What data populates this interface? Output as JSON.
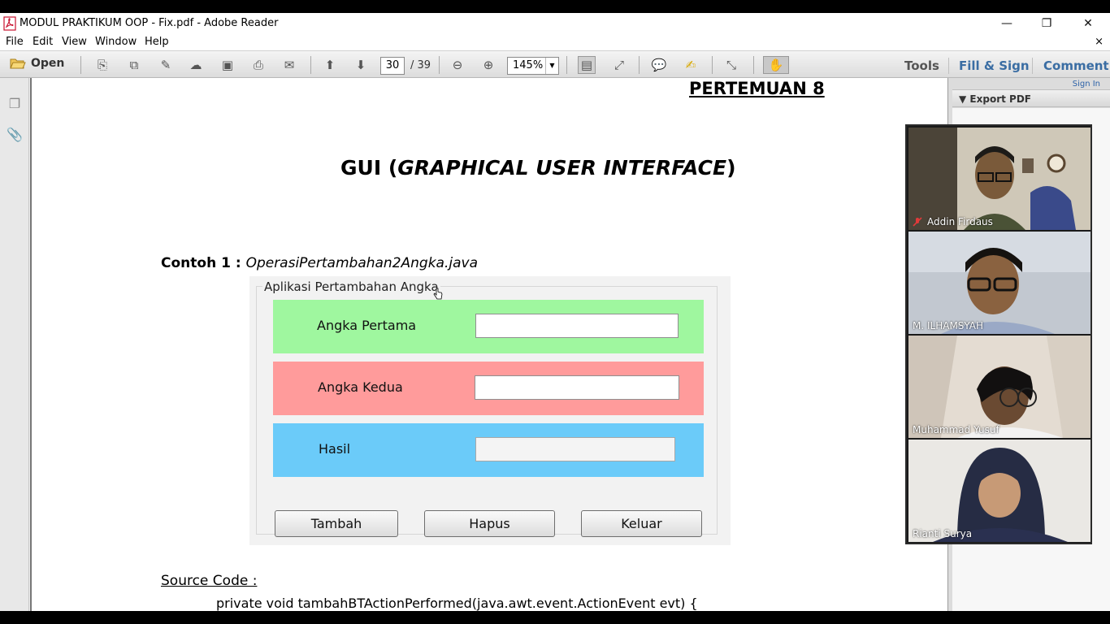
{
  "window": {
    "title": "MODUL PRAKTIKUM OOP - Fix.pdf - Adobe Reader",
    "minimize_glyph": "—",
    "maximize_glyph": "❐",
    "close_glyph": "✕"
  },
  "menu": {
    "items": [
      "File",
      "Edit",
      "View",
      "Window",
      "Help"
    ],
    "close_glyph": "×"
  },
  "toolbar": {
    "open_label": "Open",
    "current_page": "30",
    "total_pages": "/ 39",
    "zoom": "145%",
    "tools_label": "Tools",
    "fill_sign_label": "Fill & Sign",
    "comment_label": "Comment"
  },
  "document": {
    "heading": "PERTEMUAN 8",
    "title_prefix": "GUI (",
    "title_italic": "GRAPHICAL USER INTERFACE",
    "title_suffix": ")",
    "example_label": "Contoh  1 : ",
    "example_file": "OperasiPertambahan2Angka.java",
    "source_heading": "Source Code :",
    "code_line": "private void tambahBTActionPerformed(java.awt.event.ActionEvent evt) {"
  },
  "java_app": {
    "frame_title": "Aplikasi Pertambahan Angka",
    "rows": [
      {
        "label": "Angka Pertama",
        "value": "",
        "color": "#9ff79f"
      },
      {
        "label": "Angka Kedua",
        "value": "",
        "color": "#ff9b9b"
      },
      {
        "label": "Hasil",
        "value": "",
        "color": "#6bcbf9"
      }
    ],
    "buttons": [
      "Tambah",
      "Hapus",
      "Keluar"
    ]
  },
  "right_pane": {
    "sign_in": "Sign In",
    "export_pdf": "Export PDF"
  },
  "video_call": {
    "participants": [
      {
        "name": "Addin Firdaus",
        "muted": true
      },
      {
        "name": "M. ILHAMSYAH",
        "muted": false
      },
      {
        "name": "Muhammad Yusuf",
        "muted": false
      },
      {
        "name": "Rianti Surya",
        "muted": false
      }
    ]
  },
  "colors": {
    "brand_blue": "#3a6da3",
    "link_blue": "#2e63a8",
    "acrobat_red": "#c8102e"
  }
}
